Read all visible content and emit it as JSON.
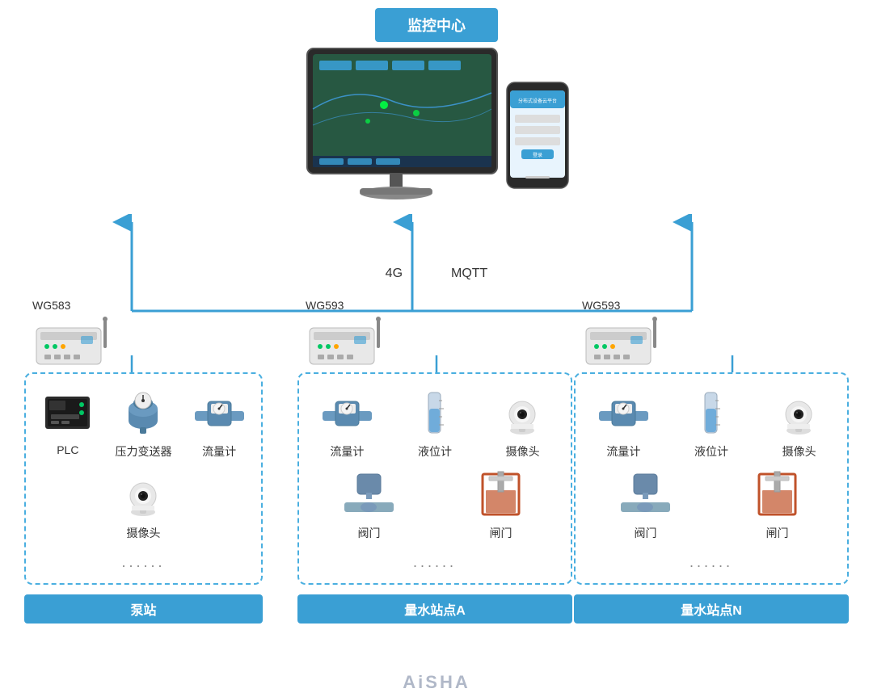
{
  "monitor_center": {
    "label": "监控中心"
  },
  "protocols": {
    "left": "4G",
    "right": "MQTT"
  },
  "stations": [
    {
      "id": "pump-station",
      "wg_model": "WG583",
      "devices": [
        {
          "name": "PLC",
          "icon": "plc"
        },
        {
          "name": "压力变送器",
          "icon": "pressure"
        },
        {
          "name": "流量计",
          "icon": "flowmeter"
        },
        {
          "name": "摄像头",
          "icon": "camera"
        }
      ],
      "show_dots": true,
      "label": "泵站"
    },
    {
      "id": "water-station-a",
      "wg_model": "WG593",
      "devices": [
        {
          "name": "流量计",
          "icon": "flowmeter"
        },
        {
          "name": "液位计",
          "icon": "level"
        },
        {
          "name": "摄像头",
          "icon": "camera"
        },
        {
          "name": "阀门",
          "icon": "valve"
        },
        {
          "name": "闸门",
          "icon": "gate"
        }
      ],
      "show_dots": true,
      "label": "量水站点A"
    },
    {
      "id": "water-station-n",
      "wg_model": "WG593",
      "devices": [
        {
          "name": "流量计",
          "icon": "flowmeter"
        },
        {
          "name": "液位计",
          "icon": "level"
        },
        {
          "name": "摄像头",
          "icon": "camera"
        },
        {
          "name": "阀门",
          "icon": "valve"
        },
        {
          "name": "闸门",
          "icon": "gate"
        }
      ],
      "show_dots": true,
      "label": "量水站点N"
    }
  ],
  "watermark": "AiSHA"
}
